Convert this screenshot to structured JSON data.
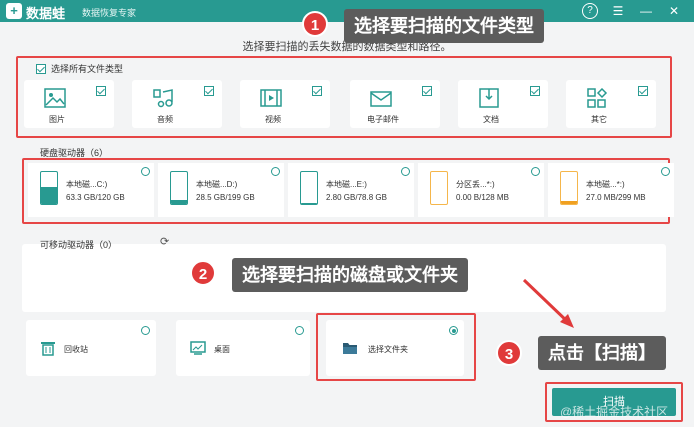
{
  "titlebar": {
    "logo_glyph": "+",
    "app_name": "数据蛙",
    "app_sub": "数据恢复专家",
    "help": "?",
    "menu": "☰",
    "minimize": "—",
    "close": "✕"
  },
  "subtitle": "选择要扫描的丢失数据的数据类型和路径。",
  "file_types": {
    "select_all_label": "选择所有文件类型",
    "items": [
      {
        "label": "图片",
        "icon": "image-icon"
      },
      {
        "label": "音频",
        "icon": "audio-icon"
      },
      {
        "label": "视频",
        "icon": "video-icon"
      },
      {
        "label": "电子邮件",
        "icon": "email-icon"
      },
      {
        "label": "文档",
        "icon": "document-icon"
      },
      {
        "label": "其它",
        "icon": "other-icon"
      }
    ]
  },
  "disk_drives": {
    "label": "硬盘驱动器（6）",
    "items": [
      {
        "name": "本地磁...C:)",
        "size": "63.3 GB/120 GB",
        "fill": 0.53,
        "color": "#289a91"
      },
      {
        "name": "本地磁...D:)",
        "size": "28.5 GB/199 GB",
        "fill": 0.14,
        "color": "#289a91"
      },
      {
        "name": "本地磁...E:)",
        "size": "2.80 GB/78.8 GB",
        "fill": 0.04,
        "color": "#289a91"
      },
      {
        "name": "分区丢...*:)",
        "size": "0.00  B/128 MB",
        "fill": 0.0,
        "color": "#f0a020"
      },
      {
        "name": "本地磁...*:)",
        "size": "27.0 MB/299 MB",
        "fill": 0.09,
        "color": "#f0a020"
      }
    ]
  },
  "removable": {
    "label": "可移动驱动器（0）"
  },
  "locations": {
    "items": [
      {
        "label": "回收站",
        "icon": "recycle-bin-icon",
        "selected": false
      },
      {
        "label": "桌面",
        "icon": "desktop-icon",
        "selected": false
      },
      {
        "label": "选择文件夹",
        "icon": "folder-icon",
        "selected": true
      }
    ]
  },
  "scan_button": "扫描",
  "callouts": [
    {
      "number": "1",
      "text": "选择要扫描的文件类型"
    },
    {
      "number": "2",
      "text": "选择要扫描的磁盘或文件夹"
    },
    {
      "number": "3",
      "text": "点击【扫描】"
    }
  ],
  "watermark": "@稀土掘金技术社区",
  "colors": {
    "accent": "#289a91",
    "highlight_red": "#e64646",
    "callout_bg": "#5c5c5c"
  }
}
